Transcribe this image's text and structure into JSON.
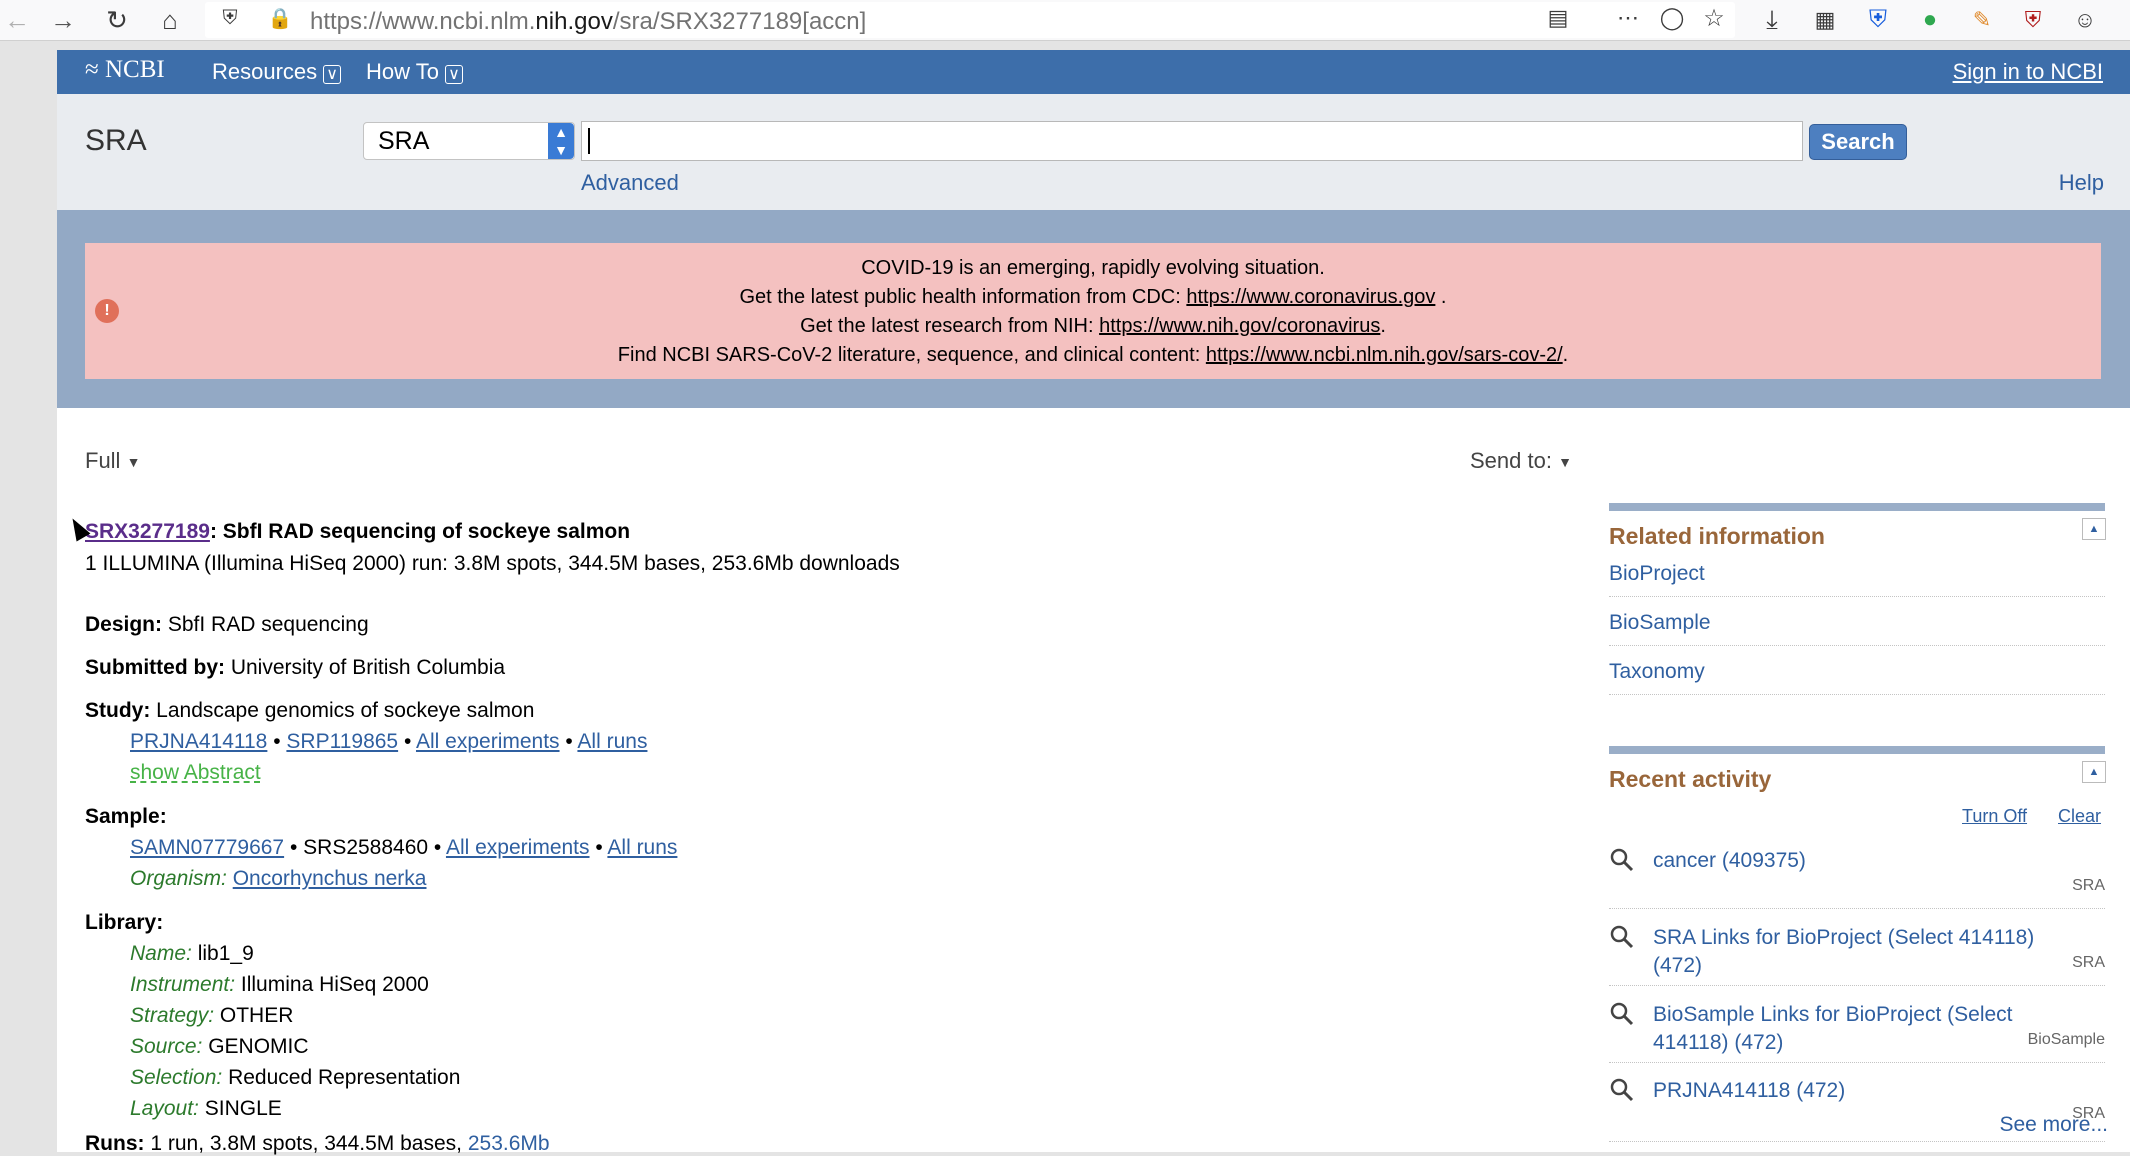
{
  "browser": {
    "url_prefix": "https://www.ncbi.nlm.",
    "url_domain": "nih.gov",
    "url_suffix": "/sra/SRX3277189[accn]"
  },
  "ncbi_bar": {
    "logo": "NCBI",
    "resources": "Resources",
    "how_to": "How To",
    "sign_in": "Sign in to NCBI"
  },
  "search": {
    "db_title": "SRA",
    "db_selected": "SRA",
    "query": "",
    "button": "Search",
    "advanced": "Advanced",
    "help": "Help"
  },
  "covid": {
    "line1": "COVID-19 is an emerging, rapidly evolving situation.",
    "line2_text": "Get the latest public health information from CDC: ",
    "line2_link": "https://www.coronavirus.gov",
    "line2_end": " .",
    "line3_text": "Get the latest research from NIH: ",
    "line3_link": "https://www.nih.gov/coronavirus",
    "line3_end": ".",
    "line4_text": "Find NCBI SARS-CoV-2 literature, sequence, and clinical content: ",
    "line4_link": "https://www.ncbi.nlm.nih.gov/sars-cov-2/",
    "line4_end": "."
  },
  "record": {
    "format": "Full",
    "send_to": "Send to:",
    "accession": "SRX3277189",
    "title": ": SbfI RAD sequencing of sockeye salmon",
    "summary": "1 ILLUMINA (Illumina HiSeq 2000) run: 3.8M spots, 344.5M bases, 253.6Mb downloads",
    "design_label": "Design:",
    "design": " SbfI RAD sequencing",
    "submitted_label": "Submitted by:",
    "submitted": " University of British Columbia",
    "study_label": "Study:",
    "study": " Landscape genomics of sockeye salmon",
    "study_links": [
      "PRJNA414118",
      "SRP119865",
      "All experiments",
      "All runs"
    ],
    "show_abstract": "show Abstract",
    "sample_label": "Sample:",
    "sample_link": "SAMN07779667",
    "sample_srs": "SRS2588460",
    "sample_links": [
      "All experiments",
      "All runs"
    ],
    "organism_label": "Organism:",
    "organism": "Oncorhynchus nerka",
    "library_label": "Library:",
    "library": [
      {
        "label": "Name:",
        "value": " lib1_9"
      },
      {
        "label": "Instrument:",
        "value": " Illumina HiSeq 2000"
      },
      {
        "label": "Strategy:",
        "value": " OTHER"
      },
      {
        "label": "Source:",
        "value": " GENOMIC"
      },
      {
        "label": "Selection:",
        "value": " Reduced Representation"
      },
      {
        "label": "Layout:",
        "value": " SINGLE"
      }
    ],
    "runs_label": "Runs:",
    "runs": " 1 run, 3.8M spots, 344.5M bases, ",
    "runs_link": "253.6Mb"
  },
  "sidebar": {
    "related_title": "Related information",
    "related": [
      "BioProject",
      "BioSample",
      "Taxonomy"
    ],
    "recent_title": "Recent activity",
    "turn_off": "Turn Off",
    "clear": "Clear",
    "recent": [
      {
        "text": "cancer (409375)",
        "db": "SRA"
      },
      {
        "text": "SRA Links for BioProject (Select 414118) (472)",
        "db": "SRA"
      },
      {
        "text": "BioSample Links for BioProject (Select 414118) (472)",
        "db": "BioSample"
      },
      {
        "text": "PRJNA414118 (472)",
        "db": "SRA"
      }
    ],
    "see_more": "See more..."
  }
}
